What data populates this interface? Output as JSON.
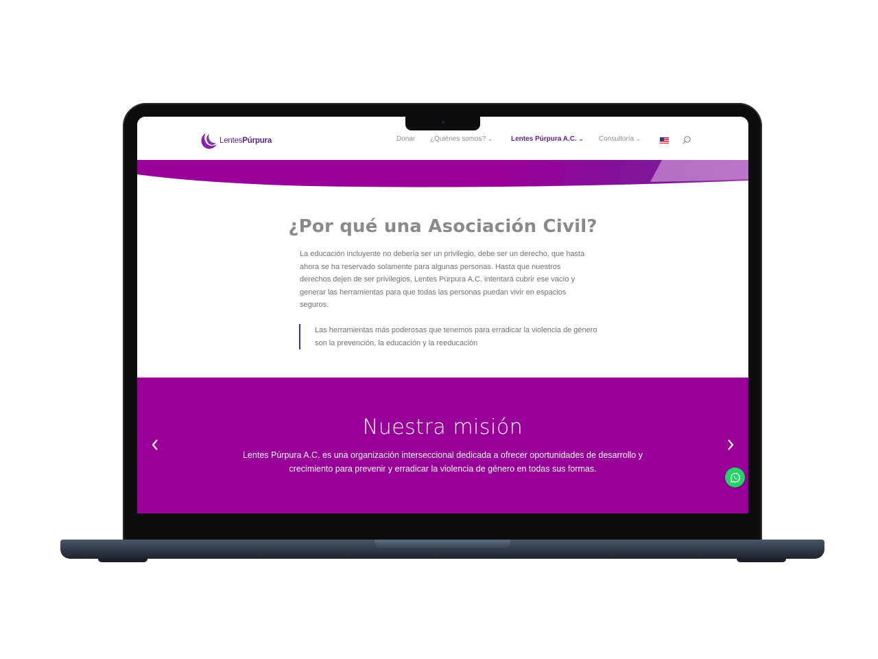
{
  "header": {
    "logo": {
      "text_regular": "Lentes",
      "text_bold": "Púrpura",
      "icon": "crescent-logo-icon"
    },
    "nav": [
      {
        "label": "Donar",
        "has_dropdown": false,
        "active": false
      },
      {
        "label": "¿Quiénes somos?",
        "has_dropdown": true,
        "active": false
      },
      {
        "label": "Lentes Púrpura A.C.",
        "has_dropdown": true,
        "active": true
      },
      {
        "label": "Consultoría",
        "has_dropdown": true,
        "active": false
      }
    ],
    "language_flag": "us-flag-icon",
    "search_icon": "search-icon"
  },
  "section_why": {
    "title": "¿Por qué una Asociación Civil?",
    "paragraph": "La educación incluyente no debería ser un privilegio, debe ser un derecho, que hasta ahora se ha reservado solamente para algunas personas. Hasta que nuestros derechos dejen de ser privilegios, Lentes Púrpura A.C. intentará cubrir ese vacío y generar las herramientas para que todas las personas puedan vivir en espacios seguros.",
    "quote": "Las herramientas más poderosas que tenemos para erradicar la violencia de género son la prevención, la educación y la reeducación"
  },
  "section_mission": {
    "title": "Nuestra misión",
    "text": "Lentes Púrpura A.C. es una organización interseccional dedicada a ofrecer oportunidades de desarrollo y crecimiento para prevenir y erradicar la violencia de género en todas sus formas."
  },
  "colors": {
    "brand_purple": "#990099",
    "logo_purple": "#5a1e8c",
    "quote_border": "#3d2a8c",
    "whatsapp_green": "#25d366"
  }
}
